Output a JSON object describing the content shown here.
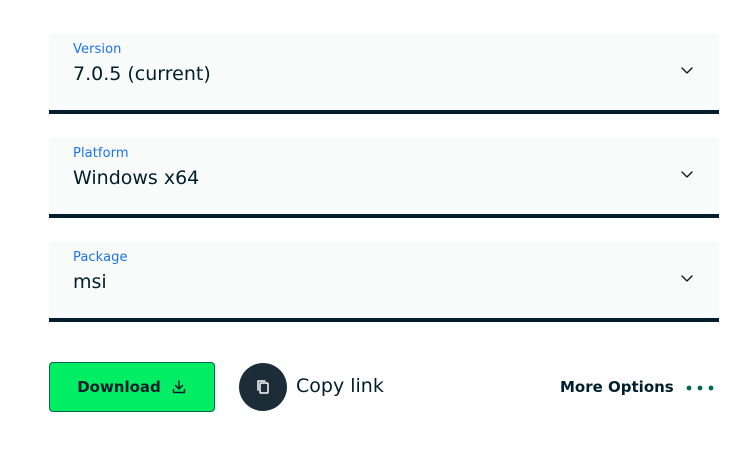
{
  "version": {
    "label": "Version",
    "value": "7.0.5 (current)",
    "icon": "chevron-down-icon"
  },
  "platform": {
    "label": "Platform",
    "value": "Windows x64",
    "icon": "chevron-down-icon"
  },
  "package": {
    "label": "Package",
    "value": "msi",
    "icon": "chevron-down-icon"
  },
  "actions": {
    "download_label": "Download",
    "download_icon": "download-icon",
    "copy_icon": "copy-icon",
    "copy_label": "Copy link",
    "more_options_label": "More Options",
    "more_icon": "more-dots-icon"
  },
  "colors": {
    "accent_label": "#1a73e8",
    "primary_text": "#001e2b",
    "download_bg": "#00ed64",
    "download_border": "#00684a",
    "copy_circle_bg": "#1c2d38",
    "dots": "#00684a",
    "field_bg": "#f9fbfa"
  }
}
